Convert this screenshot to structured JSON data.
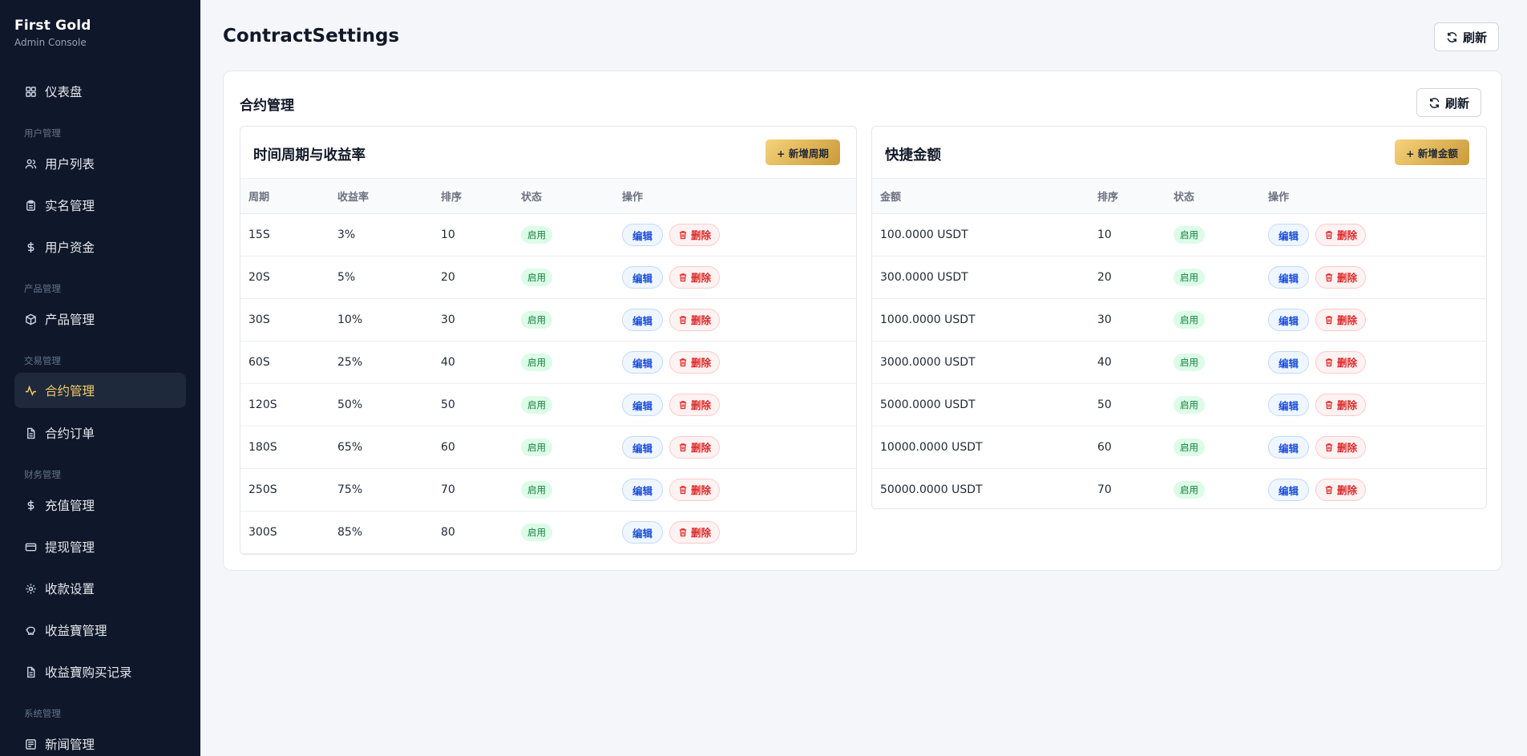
{
  "brand": {
    "title": "First Gold",
    "subtitle": "Admin Console"
  },
  "sidebar": {
    "items": [
      {
        "label": "仪表盘",
        "icon": "grid-icon"
      },
      {
        "label": "用户列表",
        "icon": "users-icon"
      },
      {
        "label": "实名管理",
        "icon": "clipboard-icon"
      },
      {
        "label": "用户资金",
        "icon": "dollar-icon"
      },
      {
        "label": "产品管理",
        "icon": "box-icon"
      },
      {
        "label": "合约管理",
        "icon": "activity-icon",
        "active": true
      },
      {
        "label": "合约订单",
        "icon": "file-icon"
      },
      {
        "label": "充值管理",
        "icon": "dollar-icon"
      },
      {
        "label": "提现管理",
        "icon": "card-icon"
      },
      {
        "label": "收款设置",
        "icon": "gear-icon"
      },
      {
        "label": "收益寶管理",
        "icon": "piggy-bank-icon"
      },
      {
        "label": "收益寶购买记录",
        "icon": "file-icon"
      },
      {
        "label": "新闻管理",
        "icon": "newspaper-icon"
      }
    ],
    "sections": [
      "用户管理",
      "产品管理",
      "交易管理",
      "财务管理",
      "系统管理"
    ]
  },
  "page": {
    "title": "ContractSettings",
    "refresh_label": "刷新"
  },
  "card": {
    "title": "合约管理",
    "refresh_label": "刷新"
  },
  "periods": {
    "title": "时间周期与收益率",
    "add_label": "+ 新增周期",
    "headers": [
      "周期",
      "收益率",
      "排序",
      "状态",
      "操作"
    ],
    "rows": [
      {
        "period": "15S",
        "rate": "3%",
        "sort": "10",
        "status": "启用"
      },
      {
        "period": "20S",
        "rate": "5%",
        "sort": "20",
        "status": "启用"
      },
      {
        "period": "30S",
        "rate": "10%",
        "sort": "30",
        "status": "启用"
      },
      {
        "period": "60S",
        "rate": "25%",
        "sort": "40",
        "status": "启用"
      },
      {
        "period": "120S",
        "rate": "50%",
        "sort": "50",
        "status": "启用"
      },
      {
        "period": "180S",
        "rate": "65%",
        "sort": "60",
        "status": "启用"
      },
      {
        "period": "250S",
        "rate": "75%",
        "sort": "70",
        "status": "启用"
      },
      {
        "period": "300S",
        "rate": "85%",
        "sort": "80",
        "status": "启用"
      }
    ]
  },
  "amounts": {
    "title": "快捷金额",
    "add_label": "+ 新增金额",
    "headers": [
      "金额",
      "排序",
      "状态",
      "操作"
    ],
    "rows": [
      {
        "amount": "100.0000 USDT",
        "sort": "10",
        "status": "启用"
      },
      {
        "amount": "300.0000 USDT",
        "sort": "20",
        "status": "启用"
      },
      {
        "amount": "1000.0000 USDT",
        "sort": "30",
        "status": "启用"
      },
      {
        "amount": "3000.0000 USDT",
        "sort": "40",
        "status": "启用"
      },
      {
        "amount": "5000.0000 USDT",
        "sort": "50",
        "status": "启用"
      },
      {
        "amount": "10000.0000 USDT",
        "sort": "60",
        "status": "启用"
      },
      {
        "amount": "50000.0000 USDT",
        "sort": "70",
        "status": "启用"
      }
    ]
  },
  "actions": {
    "edit_label": "编辑",
    "delete_label": "删除"
  },
  "colors": {
    "sidebar_bg": "#0f172a",
    "accent": "#f5c96a",
    "page_bg": "#f4f6f9"
  }
}
